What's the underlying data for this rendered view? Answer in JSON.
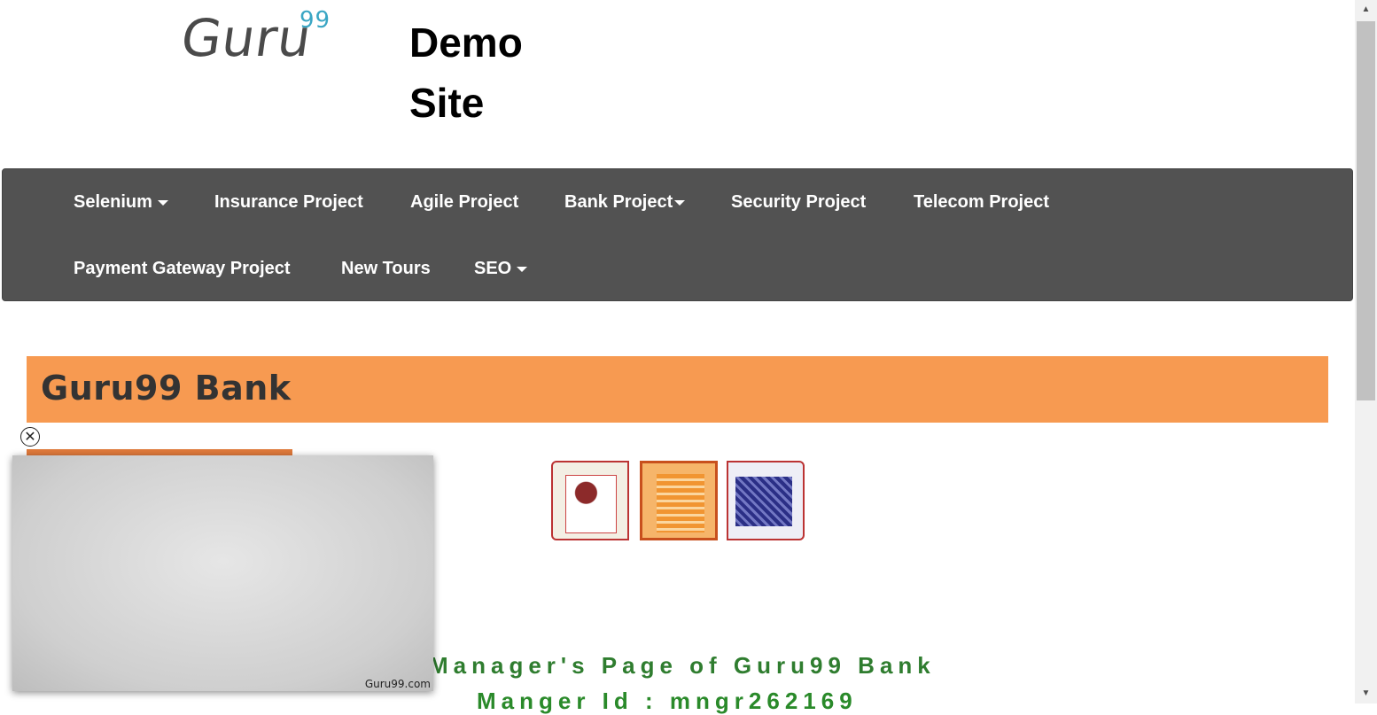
{
  "header": {
    "logo_text": "Guru",
    "logo_superscript": "99",
    "site_title": "Demo Site"
  },
  "nav": {
    "items": [
      {
        "label": "Selenium",
        "dropdown": true
      },
      {
        "label": "Insurance Project",
        "dropdown": false
      },
      {
        "label": "Agile Project",
        "dropdown": false
      },
      {
        "label": "Bank Project",
        "dropdown": true
      },
      {
        "label": "Security Project",
        "dropdown": false
      },
      {
        "label": "Telecom Project",
        "dropdown": false
      },
      {
        "label": "Payment Gateway Project",
        "dropdown": false
      },
      {
        "label": "New Tours",
        "dropdown": false
      },
      {
        "label": "SEO",
        "dropdown": true
      }
    ]
  },
  "banner": {
    "title": "Guru99 Bank"
  },
  "main": {
    "welcome_text": "Manager's Page of Guru99 Bank",
    "manager_id_text": "Manger Id : mngr262169"
  },
  "video_overlay": {
    "brand": "Guru99.com",
    "close_icon": "circle-x-icon"
  },
  "colors": {
    "navbar": "#525252",
    "banner": "#f79a51",
    "welcome_text": "#2f7d2f",
    "logo_superscript": "#3aa6c4"
  }
}
